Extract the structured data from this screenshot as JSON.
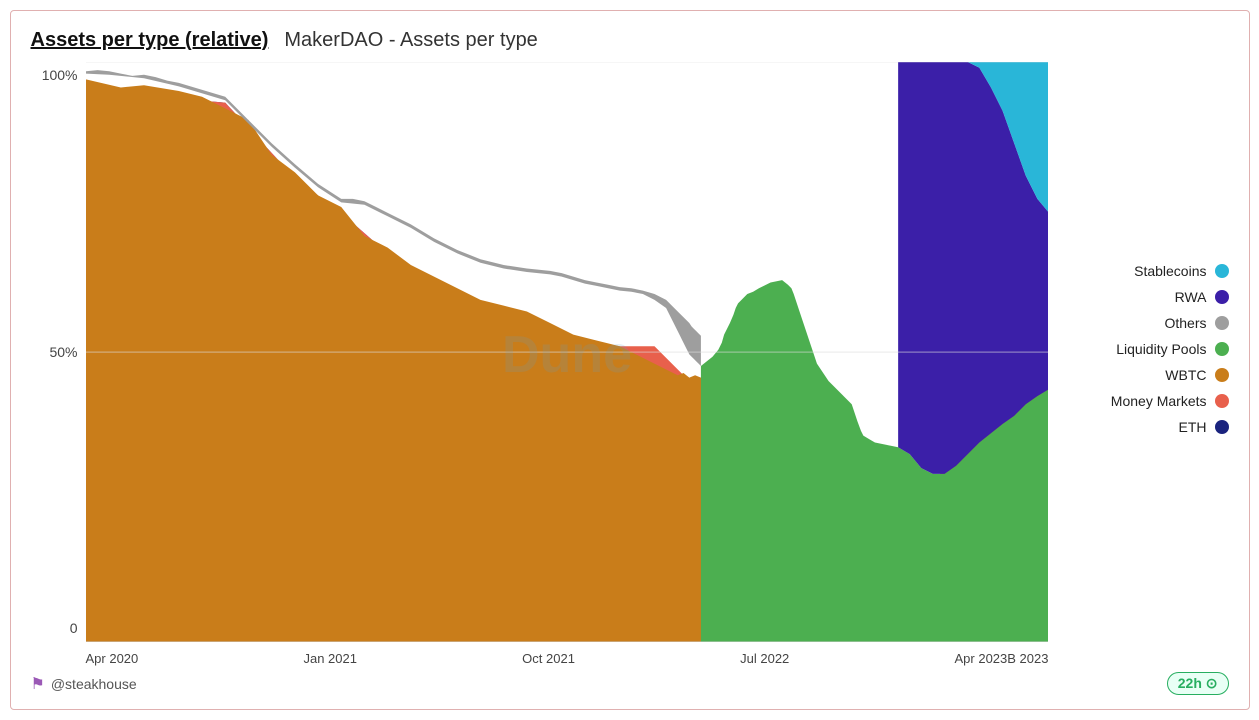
{
  "header": {
    "title_main": "Assets per type (relative)",
    "title_sub": "MakerDAO - Assets per type"
  },
  "yaxis": {
    "labels": [
      "100%",
      "50%",
      "0"
    ]
  },
  "xaxis": {
    "labels": [
      "Apr 2020",
      "Jan 2021",
      "Oct 2021",
      "Jul 2022",
      "Apr 2023",
      "B 2023"
    ]
  },
  "legend": {
    "items": [
      {
        "label": "Stablecoins",
        "color": "#29b6d8",
        "id": "stablecoins"
      },
      {
        "label": "RWA",
        "color": "#3b1fa8",
        "id": "rwa"
      },
      {
        "label": "Others",
        "color": "#9e9e9e",
        "id": "others"
      },
      {
        "label": "Liquidity Pools",
        "color": "#4caf50",
        "id": "liquidity-pools"
      },
      {
        "label": "WBTC",
        "color": "#c97d1a",
        "id": "wbtc"
      },
      {
        "label": "Money Markets",
        "color": "#e8604c",
        "id": "money-markets"
      },
      {
        "label": "ETH",
        "color": "#1a237e",
        "id": "eth"
      }
    ]
  },
  "footer": {
    "attribution": "@steakhouse",
    "time_badge": "22h"
  },
  "watermark": "Dune"
}
